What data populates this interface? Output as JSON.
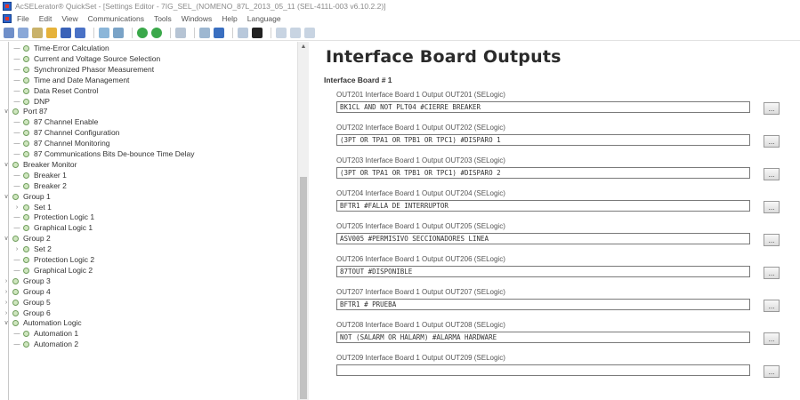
{
  "window": {
    "title": "AcSELerator® QuickSet - [Settings Editor - 7IG_SEL_(NOMENO_87L_2013_05_11 (SEL-411L-003 v6.10.2.2)]"
  },
  "menu": [
    "File",
    "Edit",
    "View",
    "Communications",
    "Tools",
    "Windows",
    "Help",
    "Language"
  ],
  "toolbar": {
    "buttons": [
      "new-icon",
      "open-icon",
      "folder-icon",
      "save-icon",
      "save-as-icon",
      "print-icon",
      "preview-icon",
      "connect-icon",
      "disconnect-icon",
      "settings-icon",
      "read-icon",
      "send-icon",
      "hmi-icon",
      "terminal-icon",
      "events-icon",
      "help-icon",
      "info-icon",
      "about-icon"
    ]
  },
  "tree": {
    "items": [
      {
        "label": "Time-Error Calculation",
        "level": 2,
        "expander": ""
      },
      {
        "label": "Current and Voltage Source Selection",
        "level": 2,
        "expander": ""
      },
      {
        "label": "Synchronized Phasor Measurement",
        "level": 2,
        "expander": ""
      },
      {
        "label": "Time and Date Management",
        "level": 2,
        "expander": ""
      },
      {
        "label": "Data Reset Control",
        "level": 2,
        "expander": ""
      },
      {
        "label": "DNP",
        "level": 2,
        "expander": ""
      },
      {
        "label": "Port 87",
        "level": 1,
        "expander": "v"
      },
      {
        "label": "87 Channel Enable",
        "level": 2,
        "expander": ""
      },
      {
        "label": "87 Channel Configuration",
        "level": 2,
        "expander": ""
      },
      {
        "label": "87 Channel Monitoring",
        "level": 2,
        "expander": ""
      },
      {
        "label": "87 Communications Bits De-bounce Time Delay",
        "level": 2,
        "expander": ""
      },
      {
        "label": "Breaker Monitor",
        "level": 1,
        "expander": "v"
      },
      {
        "label": "Breaker 1",
        "level": 2,
        "expander": ""
      },
      {
        "label": "Breaker 2",
        "level": 2,
        "expander": ""
      },
      {
        "label": "Group 1",
        "level": 1,
        "expander": "v"
      },
      {
        "label": "Set 1",
        "level": 2,
        "expander": ">"
      },
      {
        "label": "Protection Logic 1",
        "level": 2,
        "expander": ""
      },
      {
        "label": "Graphical Logic 1",
        "level": 2,
        "expander": ""
      },
      {
        "label": "Group 2",
        "level": 1,
        "expander": "v"
      },
      {
        "label": "Set 2",
        "level": 2,
        "expander": ">"
      },
      {
        "label": "Protection Logic 2",
        "level": 2,
        "expander": ""
      },
      {
        "label": "Graphical Logic 2",
        "level": 2,
        "expander": ""
      },
      {
        "label": "Group 3",
        "level": 1,
        "expander": ">"
      },
      {
        "label": "Group 4",
        "level": 1,
        "expander": ">"
      },
      {
        "label": "Group 5",
        "level": 1,
        "expander": ">"
      },
      {
        "label": "Group 6",
        "level": 1,
        "expander": ">"
      },
      {
        "label": "Automation Logic",
        "level": 1,
        "expander": "v"
      },
      {
        "label": "Automation 1",
        "level": 2,
        "expander": ""
      },
      {
        "label": "Automation 2",
        "level": 2,
        "expander": ""
      }
    ]
  },
  "content": {
    "title": "Interface Board Outputs",
    "section": "Interface Board # 1",
    "outputs": [
      {
        "label": "OUT201  Interface Board 1 Output OUT201 (SELogic)",
        "value": "BK1CL AND NOT PLT04 #CIERRE BREAKER"
      },
      {
        "label": "OUT202  Interface Board 1 Output OUT202 (SELogic)",
        "value": "(3PT OR TPA1 OR TPB1 OR TPC1) #DISPARO 1"
      },
      {
        "label": "OUT203  Interface Board 1 Output OUT203 (SELogic)",
        "value": "(3PT OR TPA1 OR TPB1 OR TPC1) #DISPARO 2"
      },
      {
        "label": "OUT204  Interface Board 1 Output OUT204 (SELogic)",
        "value": "BFTR1 #FALLA DE INTERRUPTOR"
      },
      {
        "label": "OUT205  Interface Board 1 Output OUT205 (SELogic)",
        "value": "ASV005 #PERMISIVO SECCIONADORES LINEA"
      },
      {
        "label": "OUT206  Interface Board 1 Output OUT206 (SELogic)",
        "value": "87TOUT #DISPONIBLE"
      },
      {
        "label": "OUT207  Interface Board 1 Output OUT207 (SELogic)",
        "value": "BFTR1 # PRUEBA"
      },
      {
        "label": "OUT208  Interface Board 1 Output OUT208 (SELogic)",
        "value": "NOT (SALARM OR HALARM) #ALARMA HARDWARE"
      },
      {
        "label": "OUT209  Interface Board 1 Output OUT209 (SELogic)",
        "value": ""
      }
    ],
    "browse_label": "..."
  }
}
